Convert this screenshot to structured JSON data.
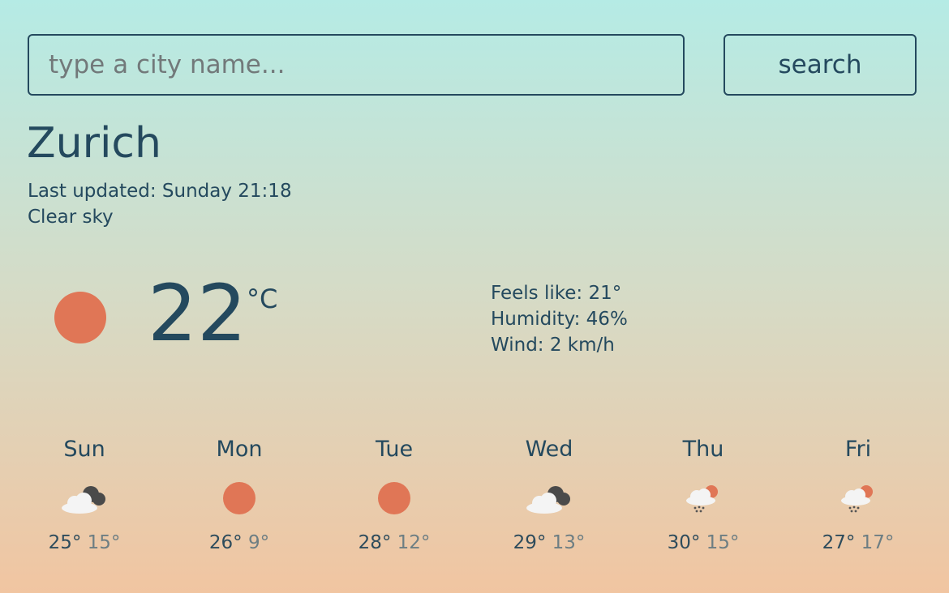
{
  "search": {
    "placeholder": "type a city name...",
    "value": "",
    "button_label": "search"
  },
  "city": "Zurich",
  "last_updated": "Last updated: Sunday 21:18",
  "description": "Clear sky",
  "current": {
    "icon": "clear-sky-icon",
    "temperature": "22",
    "unit": "°C",
    "feels_like": "Feels like: 21°",
    "humidity": "Humidity: 46%",
    "wind": "Wind: 2 km/h"
  },
  "forecast": [
    {
      "day": "Sun",
      "max": "25°",
      "min": "15°",
      "icon": "partly-cloudy-night-icon"
    },
    {
      "day": "Mon",
      "max": "26°",
      "min": "9°",
      "icon": "clear-sky-icon"
    },
    {
      "day": "Tue",
      "max": "28°",
      "min": "12°",
      "icon": "clear-sky-icon"
    },
    {
      "day": "Wed",
      "max": "29°",
      "min": "13°",
      "icon": "partly-cloudy-night-icon"
    },
    {
      "day": "Thu",
      "max": "30°",
      "min": "15°",
      "icon": "rain-icon"
    },
    {
      "day": "Fri",
      "max": "27°",
      "min": "17°",
      "icon": "rain-icon"
    }
  ],
  "colors": {
    "text": "#24495e",
    "sun": "#e07656",
    "gradient_top": "#b5ebe5",
    "gradient_bottom": "#f1c5a1"
  }
}
